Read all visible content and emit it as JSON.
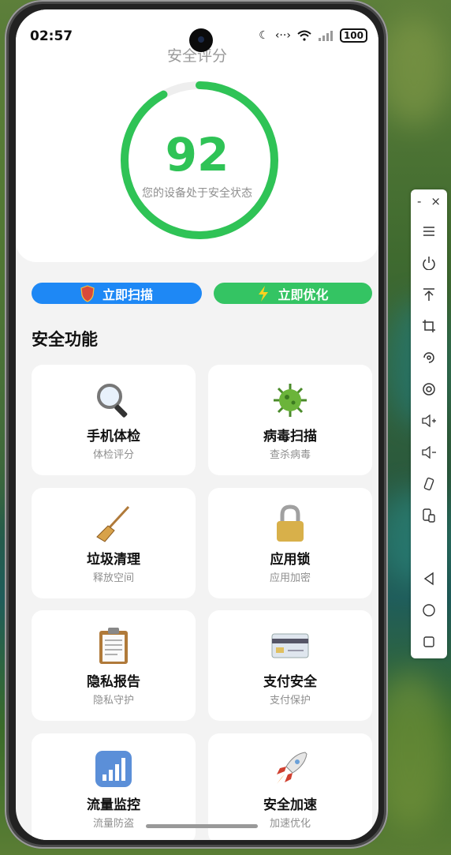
{
  "status_bar": {
    "time": "02:57",
    "icons": [
      "moon-icon",
      "data-transfer-icon",
      "wifi-icon",
      "signal-icon"
    ],
    "battery": "100"
  },
  "score": {
    "title": "安全评分",
    "value": "92",
    "status": "您的设备处于安全状态",
    "fill_fraction": 0.92,
    "color": "#2fc356"
  },
  "actions": [
    {
      "label": "立即扫描",
      "icon": "shield-icon",
      "color": "#1e88f5"
    },
    {
      "label": "立即优化",
      "icon": "lightning-icon",
      "color": "#34c463"
    }
  ],
  "section_title": "安全功能",
  "features": [
    {
      "name": "手机体检",
      "desc": "体检评分",
      "icon": "magnifier-icon"
    },
    {
      "name": "病毒扫描",
      "desc": "查杀病毒",
      "icon": "virus-icon"
    },
    {
      "name": "垃圾清理",
      "desc": "释放空间",
      "icon": "broom-icon"
    },
    {
      "name": "应用锁",
      "desc": "应用加密",
      "icon": "lock-icon"
    },
    {
      "name": "隐私报告",
      "desc": "隐私守护",
      "icon": "clipboard-icon"
    },
    {
      "name": "支付安全",
      "desc": "支付保护",
      "icon": "credit-card-icon"
    },
    {
      "name": "流量监控",
      "desc": "流量防盗",
      "icon": "bar-chart-icon"
    },
    {
      "name": "安全加速",
      "desc": "加速优化",
      "icon": "rocket-icon"
    }
  ],
  "emulator_toolbar": {
    "minimize": "-",
    "close": "×",
    "items": [
      "menu-icon",
      "power-icon",
      "pin-top-icon",
      "crop-icon",
      "rotate-icon",
      "screenshot-icon",
      "volume-up-icon",
      "volume-down-icon",
      "shake-icon",
      "device-icon",
      "back-icon",
      "home-icon",
      "recents-icon"
    ]
  }
}
